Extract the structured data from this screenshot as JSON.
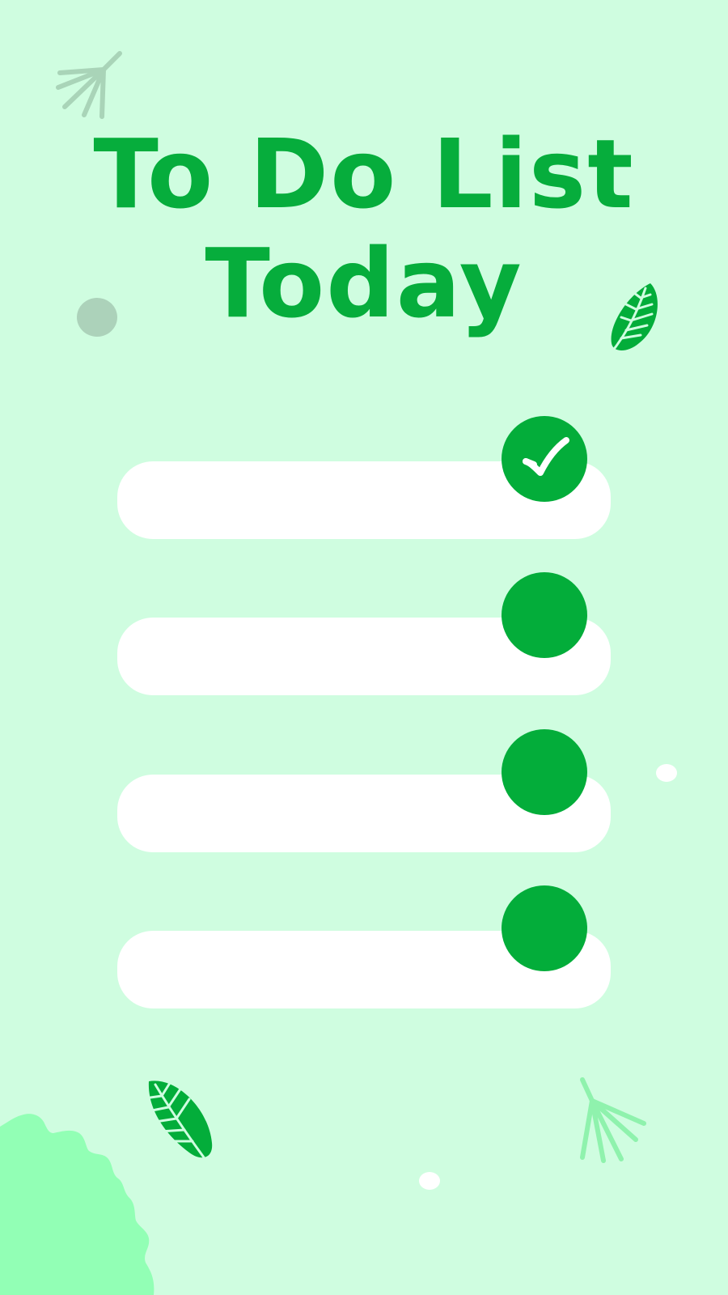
{
  "title": {
    "line1": "To Do List",
    "line2": "Today"
  },
  "tasks": [
    {
      "checked": true
    },
    {
      "checked": false
    },
    {
      "checked": false
    },
    {
      "checked": false
    }
  ],
  "icons": {
    "check": "checkmark-icon",
    "leaf": "leaf-icon",
    "sprig": "sprig-icon",
    "bush": "bush-icon"
  },
  "colors": {
    "background": "#cffde0",
    "accent": "#03ad3a",
    "field": "#ffffff",
    "sprig_muted": "#a9d4b8",
    "sprig_light": "#8ff2ad",
    "bush": "#92ffb5",
    "dot_muted": "#acd2ba"
  }
}
